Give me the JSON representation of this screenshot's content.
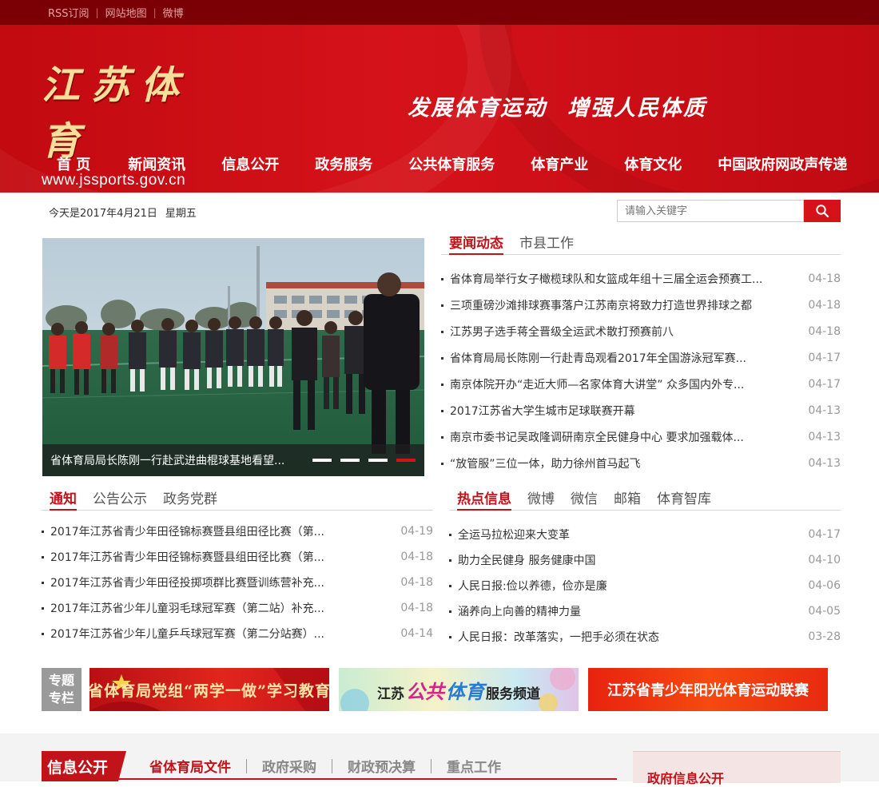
{
  "topbar": {
    "links": [
      "RSS订阅",
      "网站地图",
      "微博"
    ]
  },
  "header": {
    "logo_cn": "江苏体育",
    "logo_url": "www.jssports.gov.cn",
    "slogan": [
      "发展体育运动",
      "增强人民体质"
    ],
    "nav": [
      "首 页",
      "新闻资讯",
      "信息公开",
      "政务服务",
      "公共体育服务",
      "体育产业",
      "体育文化",
      "中国政府网政声传递"
    ]
  },
  "datebar": {
    "date": "今天是2017年4月21日",
    "weekday": "星期五"
  },
  "search": {
    "placeholder": "请输入关键字",
    "icon": "search-icon"
  },
  "slider": {
    "caption": "省体育局局长陈刚一行赴武进曲棍球基地看望...",
    "dots": 4,
    "active_dot": 4
  },
  "news": {
    "tabs": [
      "要闻动态",
      "市县工作"
    ],
    "items": [
      {
        "title": "省体育局举行女子橄榄球队和女篮成年组十三届全运会预赛工...",
        "date": "04-18"
      },
      {
        "title": "三项重磅沙滩排球赛事落户江苏南京将致力打造世界排球之都",
        "date": "04-18"
      },
      {
        "title": "江苏男子选手蒋全晋级全运武术散打预赛前八",
        "date": "04-18"
      },
      {
        "title": "省体育局局长陈刚一行赴青岛观看2017年全国游泳冠军赛...",
        "date": "04-17"
      },
      {
        "title": "南京体院开办“走近大师—名家体育大讲堂” 众多国内外专...",
        "date": "04-17"
      },
      {
        "title": "2017江苏省大学生城市足球联赛开幕",
        "date": "04-13"
      },
      {
        "title": "南京市委书记吴政隆调研南京全民健身中心 要求加强载体...",
        "date": "04-13"
      },
      {
        "title": "“放管服”三位一体，助力徐州首马起飞",
        "date": "04-13"
      }
    ]
  },
  "notices": {
    "tabs": [
      "通知",
      "公告公示",
      "政务党群"
    ],
    "items": [
      {
        "title": "2017年江苏省青少年田径锦标赛暨县组田径比赛（第...",
        "date": "04-19"
      },
      {
        "title": "2017年江苏省青少年田径锦标赛暨县组田径比赛（第...",
        "date": "04-18"
      },
      {
        "title": "2017年江苏省青少年田径投掷项群比赛暨训练营补充...",
        "date": "04-18"
      },
      {
        "title": "2017年江苏省少年儿童羽毛球冠军赛（第二站）补充...",
        "date": "04-18"
      },
      {
        "title": "2017年江苏省少年儿童乒乓球冠军赛（第二分站赛）...",
        "date": "04-14"
      }
    ]
  },
  "hot": {
    "tabs": [
      "热点信息",
      "微博",
      "微信",
      "邮箱",
      "体育智库"
    ],
    "items": [
      {
        "title": "全运马拉松迎来大变革",
        "date": "04-17"
      },
      {
        "title": "助力全民健身 服务健康中国",
        "date": "04-10"
      },
      {
        "title": "人民日报:俭以养德，俭亦是廉",
        "date": "04-06"
      },
      {
        "title": "涵养向上向善的精神力量",
        "date": "04-05"
      },
      {
        "title": "人民日报：改革落实，一把手必须在状态",
        "date": "03-28"
      }
    ]
  },
  "special": {
    "tag": [
      "专题",
      "专栏"
    ],
    "banners": [
      {
        "text": "省体育局党组“两学一做”学习教育"
      },
      {
        "pre": "江苏",
        "big1": "公共",
        "big2": "体育",
        "post": "服务频道"
      },
      {
        "text": "江苏省青少年阳光体育运动联赛"
      }
    ]
  },
  "bottom": {
    "title": "信息公开",
    "tabs": [
      "省体育局文件",
      "政府采购",
      "财政预决算",
      "重点工作"
    ],
    "right_title": "政府信息公开"
  },
  "colors": {
    "primary": "#c0141a",
    "topbar": "#7a0006",
    "header": "#d5121a"
  }
}
